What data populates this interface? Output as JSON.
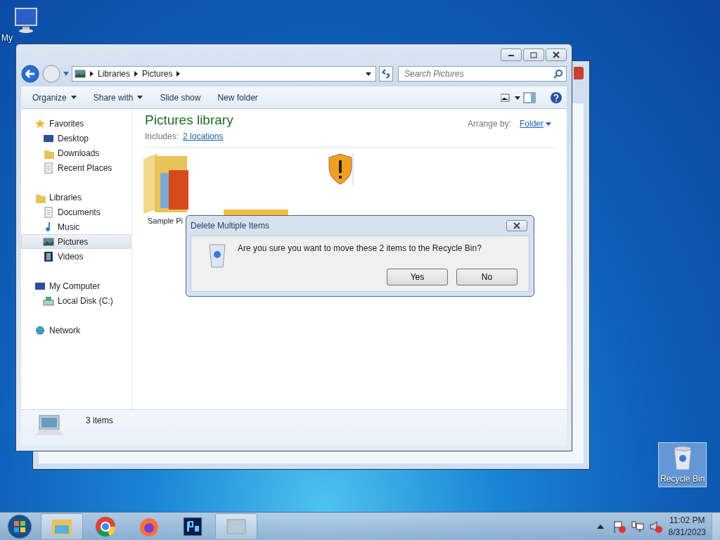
{
  "desktop_icons": [
    {
      "label": "My",
      "selected": false
    },
    {
      "label": "Recycle Bin",
      "selected": true
    }
  ],
  "explorer": {
    "breadcrumb": [
      "Libraries",
      "Pictures"
    ],
    "search": {
      "placeholder": "Search Pictures"
    },
    "toolbar": [
      {
        "label": "Organize",
        "dropdown": true
      },
      {
        "label": "Share with",
        "dropdown": true
      },
      {
        "label": "Slide show",
        "dropdown": false
      },
      {
        "label": "New folder",
        "dropdown": false
      }
    ],
    "nav_pane": [
      {
        "label": "Favorites",
        "selected": false,
        "children": [
          {
            "label": "Desktop",
            "selected": false
          },
          {
            "label": "Downloads",
            "selected": false
          },
          {
            "label": "Recent Places",
            "selected": false
          }
        ]
      },
      {
        "label": "Libraries",
        "selected": false,
        "children": [
          {
            "label": "Documents",
            "selected": false
          },
          {
            "label": "Music",
            "selected": false
          },
          {
            "label": "Pictures",
            "selected": true
          },
          {
            "label": "Videos",
            "selected": false
          }
        ]
      },
      {
        "label": "My Computer",
        "selected": false,
        "children": [
          {
            "label": "Local Disk (C:)",
            "selected": false
          }
        ]
      },
      {
        "label": "Network",
        "selected": false
      }
    ],
    "library": {
      "title": "Pictures library",
      "includes_label": "Includes:",
      "includes_link": "2 locations",
      "arrange_label": "Arrange by:",
      "arrange_value": "Folder"
    },
    "items": [
      {
        "label": "Sample Pi"
      }
    ],
    "status": "3 items"
  },
  "dialog": {
    "title": "Delete Multiple Items",
    "message": "Are you sure you want to move these 2 items to the Recycle Bin?",
    "buttons": [
      "Yes",
      "No"
    ]
  },
  "taskbar": {
    "buttons": [
      {
        "running": true
      },
      {
        "running": false
      },
      {
        "running": false
      },
      {
        "running": false
      },
      {
        "running": true
      }
    ],
    "clock": {
      "time": "11:02 PM",
      "date": "8/31/2023"
    }
  }
}
